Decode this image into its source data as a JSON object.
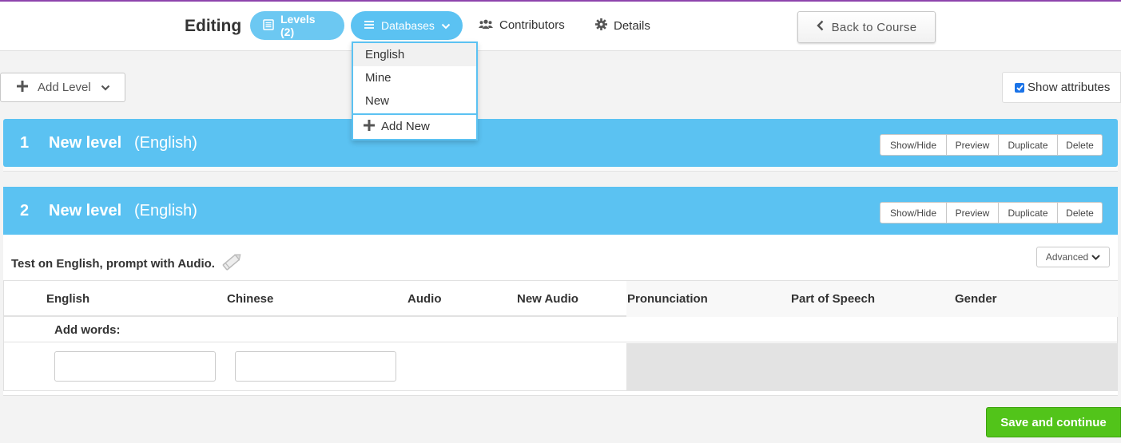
{
  "header": {
    "editing_label": "Editing",
    "tabs": {
      "levels": "Levels (2)",
      "databases": "Databases",
      "contributors": "Contributors",
      "details": "Details"
    },
    "back_button": "Back to Course"
  },
  "databases_dropdown": {
    "items": [
      "English",
      "Mine",
      "New"
    ],
    "active": "English",
    "add_new": "Add New"
  },
  "toolbar": {
    "add_level": "Add Level",
    "show_attributes": "Show attributes",
    "show_attributes_checked": true
  },
  "levels": [
    {
      "number": "1",
      "name": "New level",
      "language": "(English)"
    },
    {
      "number": "2",
      "name": "New level",
      "language": "(English)"
    }
  ],
  "level_actions": {
    "show_hide": "Show/Hide",
    "preview": "Preview",
    "duplicate": "Duplicate",
    "delete": "Delete"
  },
  "level2": {
    "test_description": "Test on English, prompt with Audio.",
    "advanced": "Advanced",
    "columns": [
      "English",
      "Chinese",
      "Audio",
      "New Audio",
      "Pronunciation",
      "Part of Speech",
      "Gender"
    ],
    "add_words_label": "Add words:"
  },
  "footer": {
    "save_continue": "Save and continue"
  },
  "colors": {
    "accent": "#5bc2f2",
    "save": "#52c41a",
    "top_line": "#8e44ad"
  }
}
